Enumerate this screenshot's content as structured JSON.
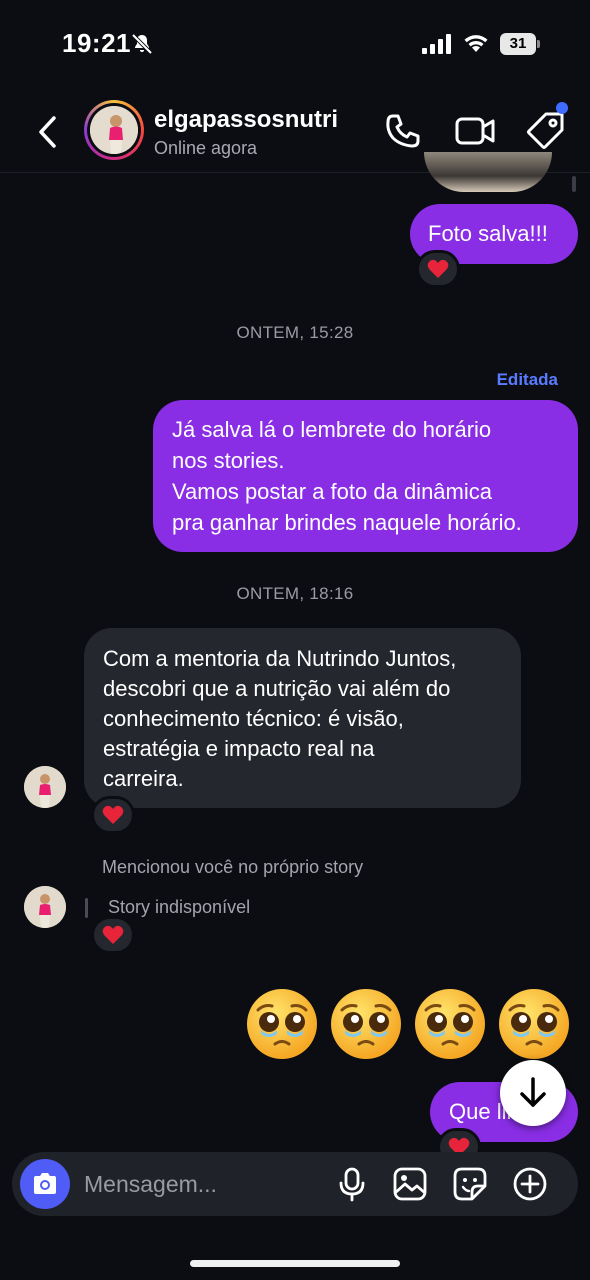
{
  "status_bar": {
    "time": "19:21",
    "battery": "31"
  },
  "header": {
    "contact_name": "elgapassosnutri",
    "contact_status": "Online agora"
  },
  "messages": {
    "foto_salva": "Foto salva!!!",
    "day_sep_1": "ONTEM, 15:28",
    "edited_label": "Editada",
    "reminder_line1": "Já salva lá o lembrete do horário",
    "reminder_line2": "nos stories.",
    "reminder_line3": "Vamos postar a foto da dinâmica",
    "reminder_line4": "pra ganhar brindes naquele horário.",
    "day_sep_2": "ONTEM, 18:16",
    "incoming_line1": "Com a mentoria da Nutrindo Juntos,",
    "incoming_line2": "descobri que a nutrição vai além do",
    "incoming_line3": "conhecimento técnico: é visão,",
    "incoming_line4": "estratégia e impacto real na",
    "incoming_line5": "carreira.",
    "story_mention": "Mencionou você no próprio story",
    "story_unavailable": "Story indisponível",
    "last_message_partial": "Que lin"
  },
  "composer": {
    "placeholder": "Mensagem..."
  },
  "colors": {
    "outgoing_bubble": "#8a2ee6",
    "incoming_bubble": "#25272e",
    "accent_blue": "#4f5cf5",
    "edited_blue": "#5b7bff",
    "background": "#0b0d12"
  },
  "icons": [
    "mute-icon",
    "signal-icon",
    "wifi-icon",
    "back-icon",
    "call-icon",
    "video-icon",
    "tag-icon",
    "heart-icon",
    "pleading-face-emoji",
    "arrow-down-icon",
    "camera-icon",
    "mic-icon",
    "gallery-icon",
    "sticker-icon",
    "plus-icon"
  ]
}
